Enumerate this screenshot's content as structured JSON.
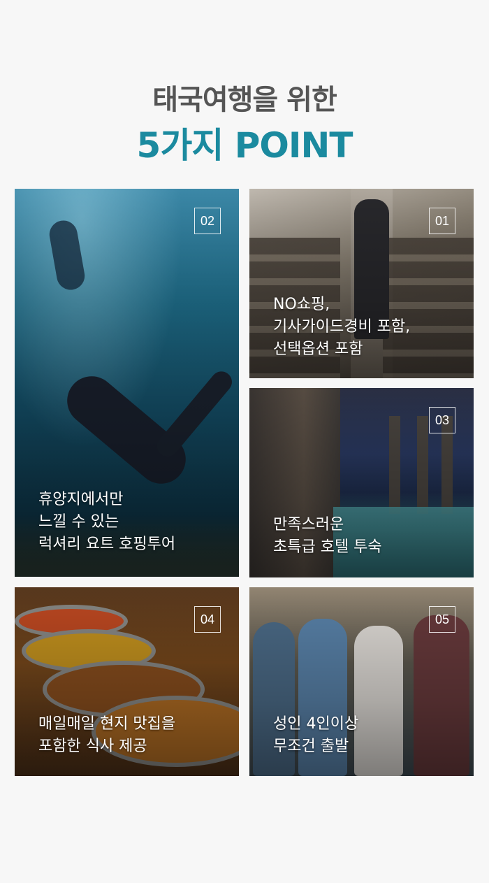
{
  "header": {
    "line1": "태국여행을 위한",
    "line2": "5가지 POINT"
  },
  "colors": {
    "accent": "#1b8a9f",
    "heading_gray": "#555555",
    "background": "#f7f7f7"
  },
  "cards": [
    {
      "number": "02",
      "photo": "underwater-snorkeling-photo",
      "lines": [
        "휴양지에서만",
        "느낄 수 있는",
        "럭셔리 요트 호핑투어"
      ]
    },
    {
      "number": "01",
      "photo": "tour-bus-guide-photo",
      "lines": [
        "NO쇼핑,",
        "기사가이드경비 포함,",
        "선택옵션 포함"
      ]
    },
    {
      "number": "03",
      "photo": "hotel-pool-photo",
      "lines": [
        "만족스러운",
        "초특급 호텔 투숙"
      ]
    },
    {
      "number": "04",
      "photo": "local-food-pans-photo",
      "lines": [
        "매일매일 현지 맛집을",
        "포함한 식사 제공"
      ]
    },
    {
      "number": "05",
      "photo": "friends-travel-photo",
      "lines": [
        "성인 4인이상",
        "무조건 출발"
      ]
    }
  ]
}
